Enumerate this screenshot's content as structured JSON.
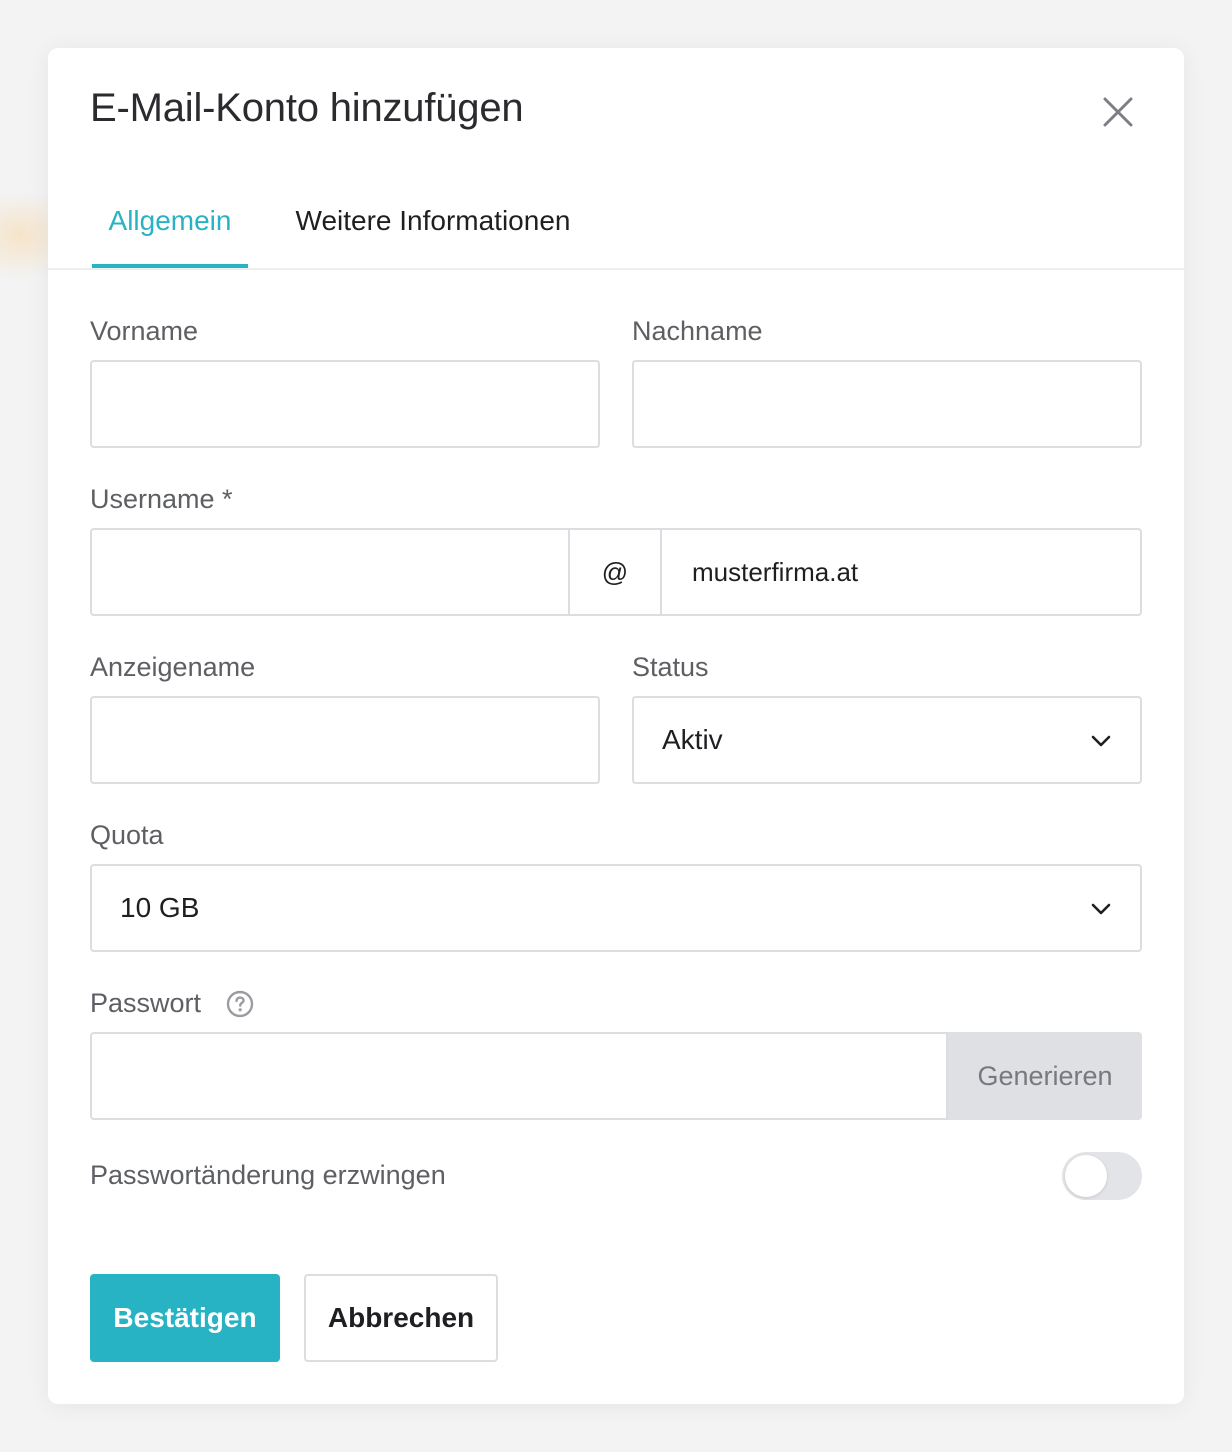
{
  "dialog": {
    "title": "E-Mail-Konto hinzufügen",
    "close_icon": "close-icon"
  },
  "tabs": [
    {
      "label": "Allgemein",
      "active": true
    },
    {
      "label": "Weitere Informationen",
      "active": false
    }
  ],
  "form": {
    "vorname": {
      "label": "Vorname",
      "value": ""
    },
    "nachname": {
      "label": "Nachname",
      "value": ""
    },
    "username": {
      "label": "Username *",
      "value": "",
      "at_symbol": "@",
      "domain": "musterfirma.at"
    },
    "anzeigename": {
      "label": "Anzeigename",
      "value": ""
    },
    "status": {
      "label": "Status",
      "selected": "Aktiv"
    },
    "quota": {
      "label": "Quota",
      "selected": "10 GB"
    },
    "passwort": {
      "label": "Passwort",
      "value": "",
      "help_icon": "question-circle-icon",
      "generate_label": "Generieren"
    },
    "force_change": {
      "label": "Passwortänderung erzwingen",
      "enabled": false
    }
  },
  "actions": {
    "confirm_label": "Bestätigen",
    "cancel_label": "Abbrechen"
  },
  "colors": {
    "accent": "#27b3c4",
    "border": "#dcdde0",
    "label": "#5d5f63"
  }
}
